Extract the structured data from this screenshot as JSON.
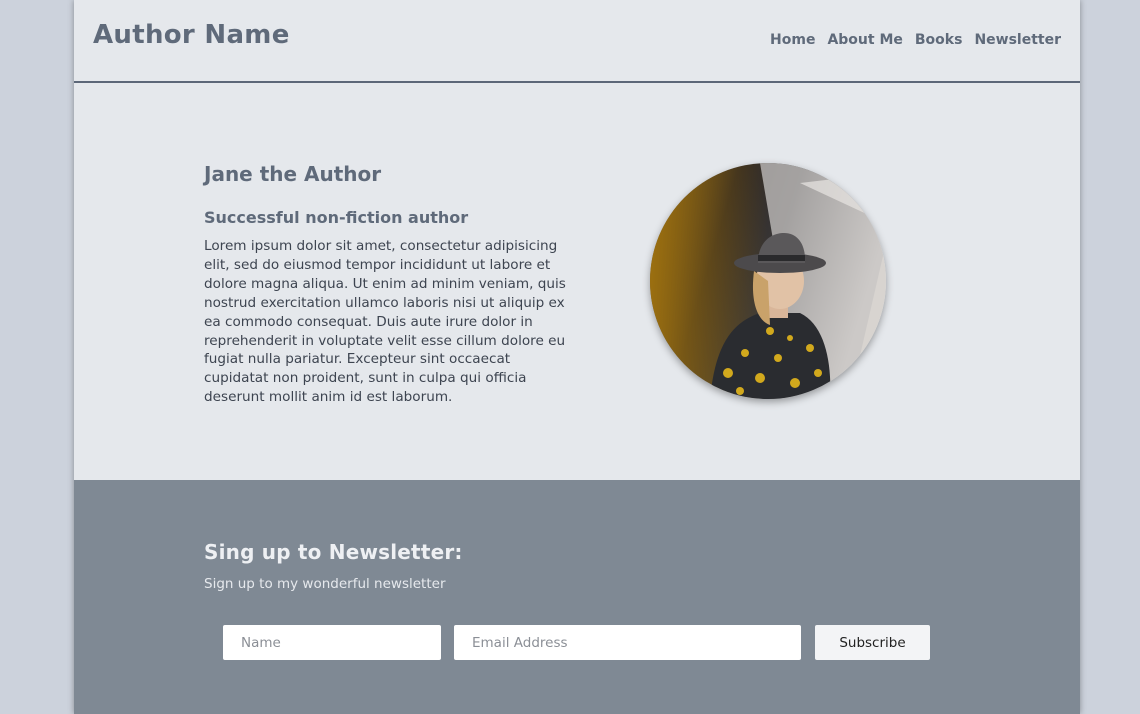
{
  "header": {
    "brand": "Author Name",
    "nav": [
      "Home",
      "About Me",
      "Books",
      "Newsletter"
    ]
  },
  "hero": {
    "title": "Jane the Author",
    "subtitle": "Successful non-fiction author",
    "body": "Lorem ipsum dolor sit amet, consectetur adipisicing elit, sed do eiusmod tempor incididunt ut labore et dolore magna aliqua. Ut enim ad minim veniam, quis nostrud exercitation ullamco laboris nisi ut aliquip ex ea commodo consequat. Duis aute irure dolor in reprehenderit in voluptate velit esse cillum dolore eu fugiat nulla pariatur. Excepteur sint occaecat cupidatat non proident, sunt in culpa qui officia deserunt mollit anim id est laborum.",
    "portrait_icon": "author-portrait-photo"
  },
  "newsletter": {
    "title": "Sing up to Newsletter:",
    "subtitle": "Sign up to my wonderful newsletter",
    "name_placeholder": "Name",
    "email_placeholder": "Email Address",
    "subscribe_label": "Subscribe"
  },
  "colors": {
    "page_bg": "#e5e8ec",
    "outer_bg": "#ccd2dc",
    "text_heading": "#5f6a7a",
    "newsletter_bg": "#7f8994"
  }
}
